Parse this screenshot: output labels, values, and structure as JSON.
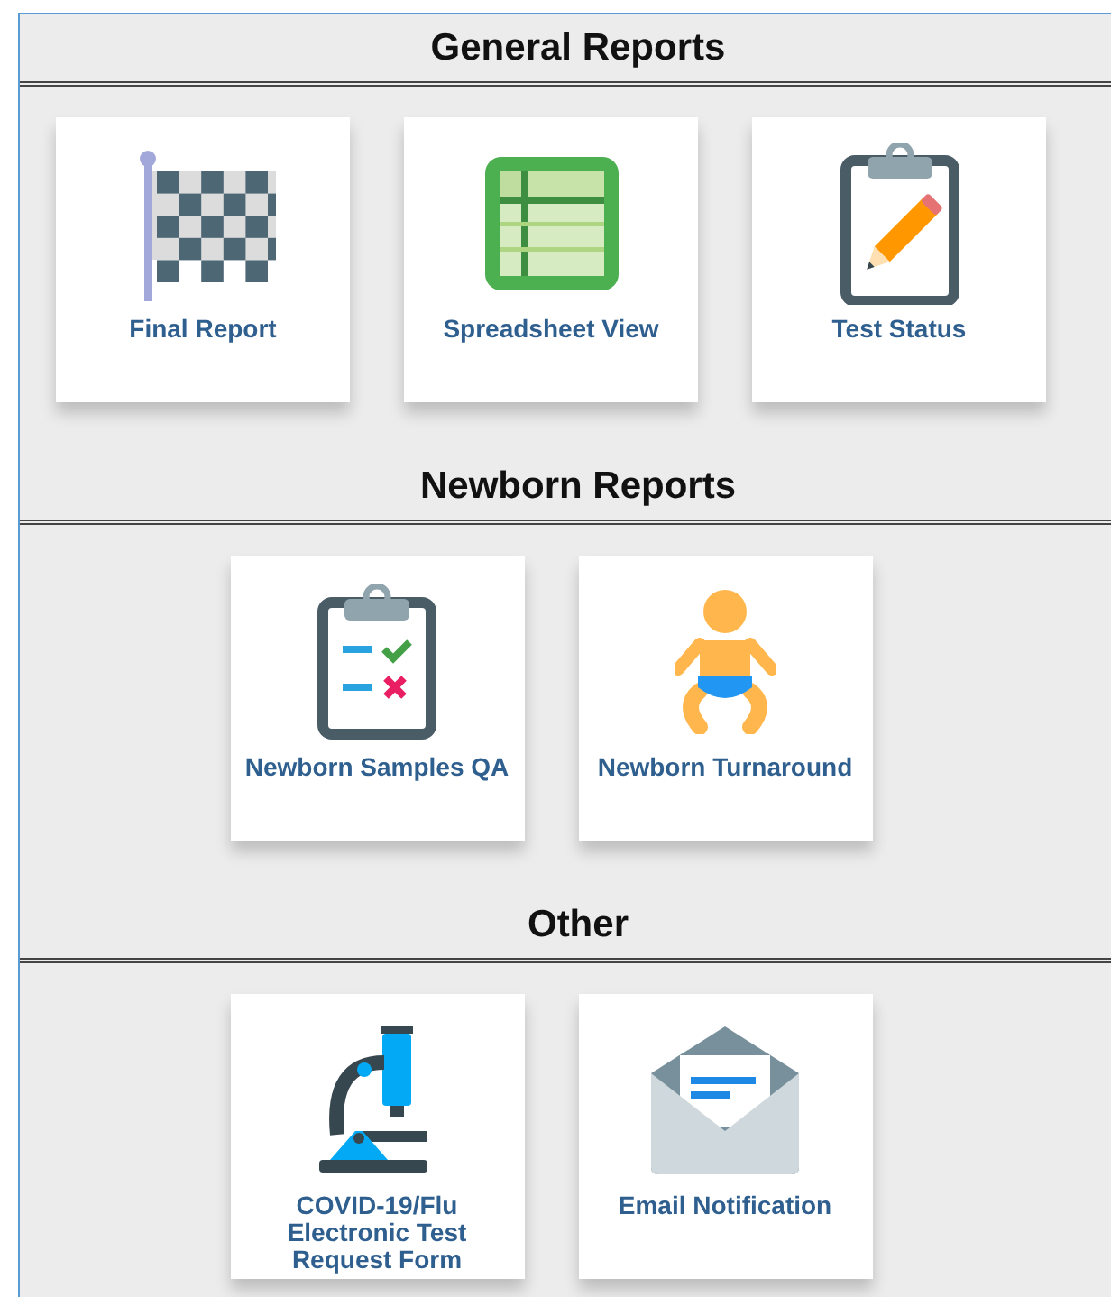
{
  "sections": [
    {
      "title": "General Reports",
      "items": [
        {
          "label": "Final Report",
          "kind": "flag"
        },
        {
          "label": "Spreadsheet View",
          "kind": "spreadsheet"
        },
        {
          "label": "Test Status",
          "kind": "clipboard-pencil"
        }
      ]
    },
    {
      "title": "Newborn Reports",
      "items": [
        {
          "label": "Newborn Samples QA",
          "kind": "clipboard-check"
        },
        {
          "label": "Newborn Turnaround",
          "kind": "baby"
        }
      ]
    },
    {
      "title": "Other",
      "items": [
        {
          "label": "COVID-19/Flu Electronic Test Request Form",
          "kind": "microscope"
        },
        {
          "label": "Email Notification",
          "kind": "envelope"
        }
      ]
    }
  ]
}
